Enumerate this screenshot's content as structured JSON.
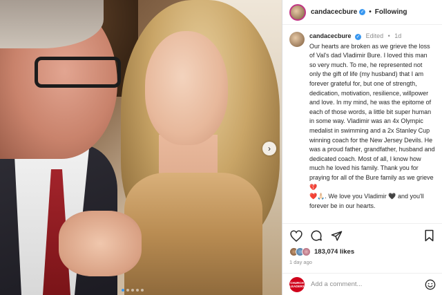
{
  "post": {
    "username": "candacecbure",
    "following_label": "Following",
    "separator": "•",
    "verified_glyph": "✓",
    "next_glyph": "›",
    "photo_dots": 5,
    "active_dot": 0
  },
  "caption": {
    "username": "candacecbure",
    "edited_label": "Edited",
    "time": "1d",
    "separator": "•",
    "text": "Our hearts are broken as we grieve the loss of Val's dad Vladimir Bure. I loved this man so very much. To me, he represented not only the gift of life (my husband) that I am forever grateful for, but one of strength, dedication, motivation, resilience, willpower and love. In my mind, he was the epitome of each of those words, a little bit super human in some way. Vladimir was an 4x Olympic medalist in swimming and a 2x Stanley Cup winning coach for the New Jersey Devils. He was a proud father, grandfather, husband and dedicated coach. Most of all, I know how much he loved his family. Thank you for praying for all of the Bure family as we grieve ",
    "emoji_1": "💔",
    "emoji_2": "❤️🙏🏻",
    "text_2": ". We love you Vladimir ",
    "emoji_3": "🖤",
    "text_3": " and you'll forever be in our hearts."
  },
  "engagement": {
    "likes": "183,074 likes",
    "time_ago": "1 day ago"
  },
  "comment": {
    "placeholder": "Add a comment...",
    "avatar_text": "CHURCH LEADERS"
  },
  "icons": [
    "heart-icon",
    "comment-icon",
    "share-icon",
    "bookmark-icon",
    "emoji-icon",
    "chevron-right-icon"
  ],
  "colors": {
    "verified": "#3897f0",
    "secondary_text": "#8e8e8e",
    "comment_avatar": "#d0021b"
  }
}
